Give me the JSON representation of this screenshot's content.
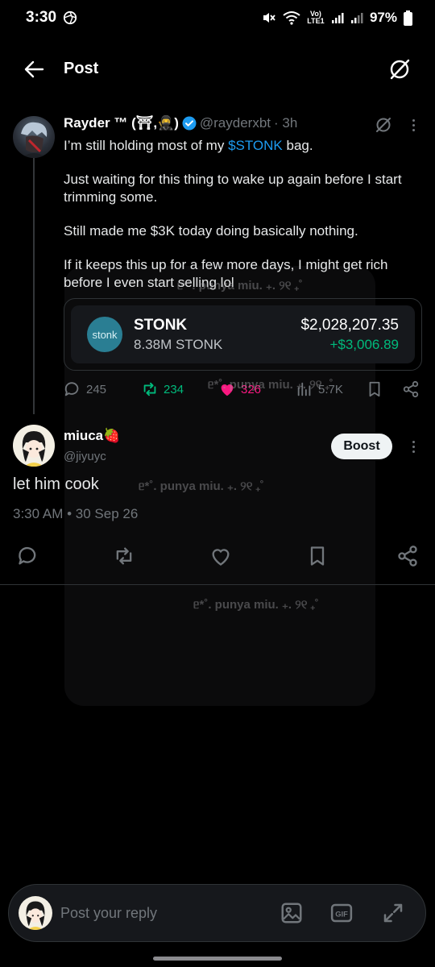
{
  "status_bar": {
    "time": "3:30",
    "network_label": "Vo) LTE1",
    "battery": "97%"
  },
  "header": {
    "title": "Post",
    "back_icon": "arrow-left-icon",
    "grok_icon": "grok-icon"
  },
  "post": {
    "author_name": "Rayder ™ (⛩,🥷)",
    "handle": "@rayderxbt",
    "time_ago": "· 3h",
    "body": {
      "line1_before": "I’m still holding most of my ",
      "cashtag": "$STONK",
      "line1_after": " bag.",
      "p2": "Just waiting for this thing to wake up again before I start trimming some.",
      "p3": "Still made me $3K today doing basically nothing.",
      "p4": "If it keeps this up for a few more days, I might get rich before I even start selling lol"
    },
    "token_card": {
      "logo_text": "stonk",
      "name": "STONK",
      "amount": "8.38M STONK",
      "value": "$2,028,207.35",
      "gain": "+$3,006.89"
    },
    "stats": {
      "replies": "245",
      "reposts": "234",
      "likes": "326",
      "views": "5.7K"
    }
  },
  "reply": {
    "author_name": "miuca🍓",
    "handle": "@jiyuyc",
    "boost_label": "Boost",
    "text": "let him cook",
    "timestamp": "3:30 AM • 30 Sep 26"
  },
  "watermarks": {
    "w1": "ᥱ*˚. punya miu.  ₊. ୨୧ ₊˚",
    "w2": "ᥱ*˚. punya miu.  ₊. ୨୧ ₊˚",
    "w3": "ᥱ*˚. punya miu.  ₊. ୨୧ ₊˚",
    "w4": "ᥱ*˚. punya miu.  ₊. ୨୧ ₊˚"
  },
  "composer": {
    "placeholder": "Post your reply",
    "gif_label": "GIF"
  },
  "colors": {
    "accent_blue": "#1d9bf0",
    "repost_green": "#00ba7c",
    "like_pink": "#f91880",
    "muted_gray": "#71767b"
  }
}
